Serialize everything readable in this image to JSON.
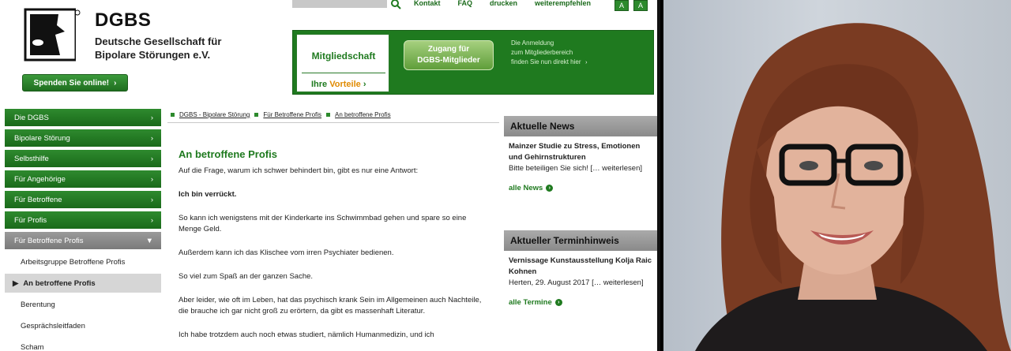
{
  "header": {
    "logo_title": "DGBS",
    "logo_sub_line1": "Deutsche Gesellschaft für",
    "logo_sub_line2": "Bipolare Störungen e.V.",
    "donate_label": "Spenden Sie online!",
    "topnav": [
      "Kontakt",
      "FAQ",
      "drucken",
      "weiterempfehlen"
    ],
    "font_buttons": [
      "A",
      "A"
    ]
  },
  "member": {
    "title": "Mitgliedschaft",
    "vorteile_prefix": "Ihre",
    "vorteile_highlight": "Vorteile",
    "access_line1": "Zugang für",
    "access_line2": "DGBS-Mitglieder",
    "note_line1": "Die Anmeldung",
    "note_line2": "zum Mitgliederbereich",
    "note_line3": "finden Sie nun direkt hier"
  },
  "sidebar": {
    "items": [
      "Die DGBS",
      "Bipolare Störung",
      "Selbsthilfe",
      "Für Angehörige",
      "Für Betroffene",
      "Für Profis"
    ],
    "open_item": "Für Betroffene Profis",
    "sub_items": [
      "Arbeitsgruppe Betroffene Profis",
      "An betroffene Profis",
      "Berentung",
      "Gesprächsleitfaden",
      "Scham"
    ]
  },
  "breadcrumb": [
    "DGBS - Bipolare Störung",
    "Für Betroffene Profis",
    "An betroffene Profis"
  ],
  "main": {
    "title": "An betroffene Profis",
    "p1": "Auf die Frage, warum ich schwer behindert bin, gibt es nur eine Antwort:",
    "p2": "Ich bin verrückt.",
    "p3": "So kann ich wenigstens mit der Kinderkarte ins Schwimmbad gehen und spare so eine Menge Geld.",
    "p4": "Außerdem kann ich das Klischee vom irren Psychiater bedienen.",
    "p5": "So viel zum Spaß an der ganzen Sache.",
    "p6": "Aber leider, wie oft im Leben, hat das psychisch krank Sein im Allgemeinen auch Nachteile, die brauche ich gar nicht groß zu erörtern, da gibt es massenhaft Literatur.",
    "p7": "Ich habe trotzdem auch noch etwas studiert, nämlich Humanmedizin, und ich"
  },
  "news": {
    "head": "Aktuelle News",
    "headline": "Mainzer Studie zu Stress, Emotionen und Gehirnstrukturen",
    "text": "Bitte beteiligen Sie sich!",
    "more_inline": "[… weiterlesen]",
    "all": "alle News"
  },
  "termin": {
    "head": "Aktueller Terminhinweis",
    "headline": "Vernissage Kunstausstellung Kolja Raic Kohnen",
    "text": "Herten, 29. August 2017",
    "more_inline": "[… weiterlesen]",
    "all": "alle Termine"
  },
  "colors": {
    "brand_green": "#1f7a1f",
    "accent_orange": "#e08a00",
    "nav_grey": "#8a8a8a"
  }
}
